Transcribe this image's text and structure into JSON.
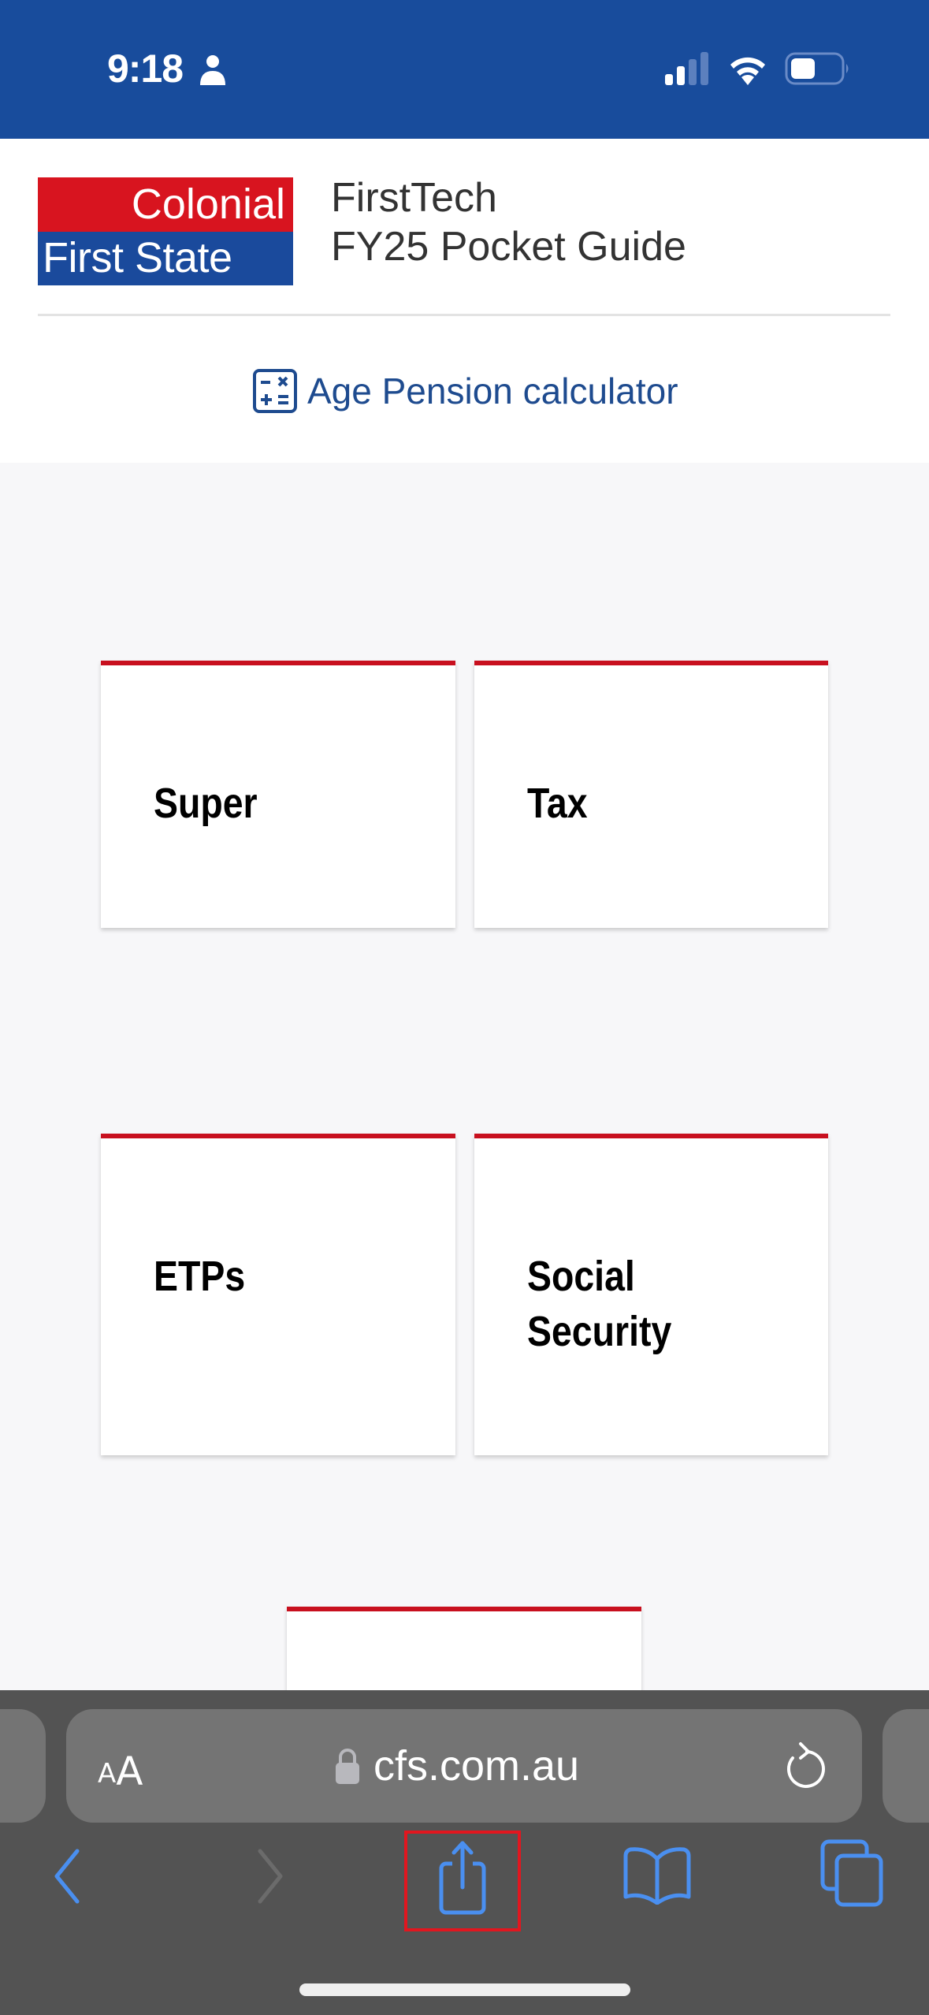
{
  "status_bar": {
    "time": "9:18",
    "icons": [
      "person-icon",
      "cellular-signal-icon",
      "wifi-icon",
      "battery-icon"
    ],
    "signal_bars_active": 2,
    "signal_bars_total": 4,
    "battery_level": 0.5
  },
  "header": {
    "logo": {
      "line1": "Colonial",
      "line2": "First State",
      "colors": {
        "top": "#d8141f",
        "bottom": "#1a4a9c"
      }
    },
    "title_line1": "FirstTech",
    "title_line2": "FY25 Pocket Guide",
    "calculator_link": {
      "icon": "calculator-icon",
      "label": "Age Pension calculator"
    }
  },
  "cards": [
    {
      "label": "Super"
    },
    {
      "label": "Tax"
    },
    {
      "label": "ETPs"
    },
    {
      "label_line1": "Social",
      "label_line2": "Security"
    },
    {
      "label": ""
    }
  ],
  "browser": {
    "text_size_button": {
      "small": "A",
      "large": "A"
    },
    "url": "cfs.com.au",
    "secure": true,
    "toolbar_buttons": [
      "back",
      "forward",
      "share",
      "bookmarks",
      "tabs"
    ],
    "highlighted_button": "share"
  },
  "colors": {
    "brand_blue": "#184c9c",
    "link_blue": "#1e4b8f",
    "card_accent_red": "#c8101f",
    "safari_blue": "#4a8ff0",
    "toolbar_bg": "#535353",
    "highlight_red": "#e2161f"
  }
}
